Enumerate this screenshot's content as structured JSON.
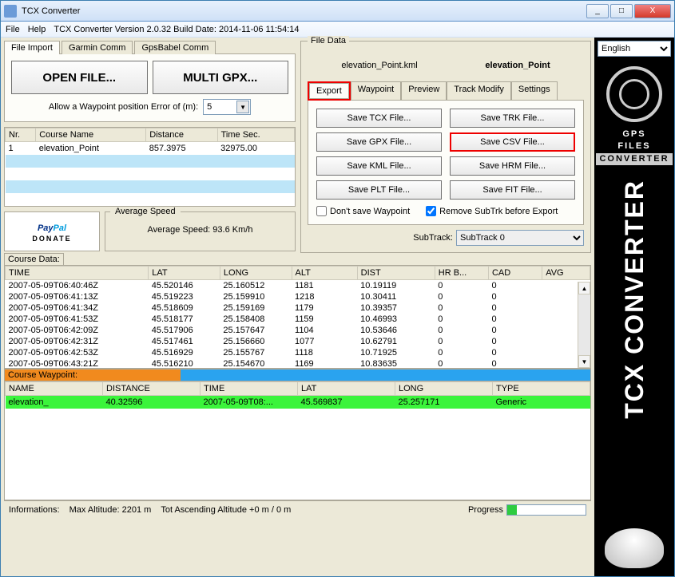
{
  "window": {
    "title": "TCX Converter"
  },
  "menu": {
    "file": "File",
    "help": "Help",
    "version": "TCX Converter Version 2.0.32 Build Date: 2014-11-06 11:54:14"
  },
  "wbtns": {
    "min": "_",
    "max": "□",
    "close": "X"
  },
  "lang": {
    "selected": "English"
  },
  "filetabs": {
    "t0": "File Import",
    "t1": "Garmin Comm",
    "t2": "GpsBabel Comm"
  },
  "buttons": {
    "open": "OPEN FILE...",
    "multi": "MULTI GPX..."
  },
  "wp": {
    "label": "Allow a Waypoint position Error of (m):",
    "value": "5"
  },
  "course": {
    "hdr": {
      "nr": "Nr.",
      "name": "Course Name",
      "dist": "Distance",
      "time": "Time Sec."
    },
    "rows": [
      {
        "nr": "1",
        "name": "elevation_Point",
        "dist": "857.3975",
        "time": "32975.00"
      }
    ]
  },
  "avg": {
    "title": "Average Speed",
    "value": "Average Speed: 93.6 Km/h"
  },
  "paypal": {
    "pay": "Pay",
    "pal": "Pal",
    "donate": "DONATE"
  },
  "filedata": {
    "legend": "File Data",
    "file": "elevation_Point.kml",
    "name": "elevation_Point"
  },
  "subtabs": {
    "t0": "Export",
    "t1": "Waypoint",
    "t2": "Preview",
    "t3": "Track Modify",
    "t4": "Settings"
  },
  "export": {
    "tcx": "Save TCX File...",
    "trk": "Save TRK File...",
    "gpx": "Save GPX File...",
    "csv": "Save CSV File...",
    "kml": "Save KML File...",
    "hrm": "Save HRM File...",
    "plt": "Save PLT File...",
    "fit": "Save FIT File...",
    "dontsave": "Don't save Waypoint",
    "remove": "Remove SubTrk before Export"
  },
  "subtrack": {
    "label": "SubTrack:",
    "value": "SubTrack 0"
  },
  "cd": {
    "label": "Course Data:",
    "hdr": {
      "time": "TIME",
      "lat": "LAT",
      "long": "LONG",
      "alt": "ALT",
      "dist": "DIST",
      "hr": "HR B...",
      "cad": "CAD",
      "avg": "AVG"
    },
    "rows": [
      {
        "time": "2007-05-09T06:40:46Z",
        "lat": "45.520146",
        "long": "25.160512",
        "alt": "1181",
        "dist": "10.19119",
        "hr": "0",
        "cad": "0",
        "avg": ""
      },
      {
        "time": "2007-05-09T06:41:13Z",
        "lat": "45.519223",
        "long": "25.159910",
        "alt": "1218",
        "dist": "10.30411",
        "hr": "0",
        "cad": "0",
        "avg": ""
      },
      {
        "time": "2007-05-09T06:41:34Z",
        "lat": "45.518609",
        "long": "25.159169",
        "alt": "1179",
        "dist": "10.39357",
        "hr": "0",
        "cad": "0",
        "avg": ""
      },
      {
        "time": "2007-05-09T06:41:53Z",
        "lat": "45.518177",
        "long": "25.158408",
        "alt": "1159",
        "dist": "10.46993",
        "hr": "0",
        "cad": "0",
        "avg": ""
      },
      {
        "time": "2007-05-09T06:42:09Z",
        "lat": "45.517906",
        "long": "25.157647",
        "alt": "1104",
        "dist": "10.53646",
        "hr": "0",
        "cad": "0",
        "avg": ""
      },
      {
        "time": "2007-05-09T06:42:31Z",
        "lat": "45.517461",
        "long": "25.156660",
        "alt": "1077",
        "dist": "10.62791",
        "hr": "0",
        "cad": "0",
        "avg": ""
      },
      {
        "time": "2007-05-09T06:42:53Z",
        "lat": "45.516929",
        "long": "25.155767",
        "alt": "1118",
        "dist": "10.71925",
        "hr": "0",
        "cad": "0",
        "avg": ""
      },
      {
        "time": "2007-05-09T06:43:21Z",
        "lat": "45.516210",
        "long": "25.154670",
        "alt": "1169",
        "dist": "10.83635",
        "hr": "0",
        "cad": "0",
        "avg": ""
      }
    ]
  },
  "cw": {
    "label": "Course Waypoint:",
    "hdr": {
      "name": "NAME",
      "dist": "DISTANCE",
      "time": "TIME",
      "lat": "LAT",
      "long": "LONG",
      "type": "TYPE"
    },
    "rows": [
      {
        "name": "elevation_",
        "dist": "40.32596",
        "time": "2007-05-09T08:...",
        "lat": "45.569837",
        "long": "25.257171",
        "type": "Generic"
      }
    ]
  },
  "status": {
    "info": "Informations:",
    "maxalt": "Max Altitude: 2201 m",
    "totasc": "Tot Ascending Altitude +0 m / 0 m",
    "progress": "Progress"
  },
  "side": {
    "gps": "GPS",
    "files": "FILES",
    "conv": "CONVERTER",
    "vtext": "TCX CONVERTER"
  }
}
